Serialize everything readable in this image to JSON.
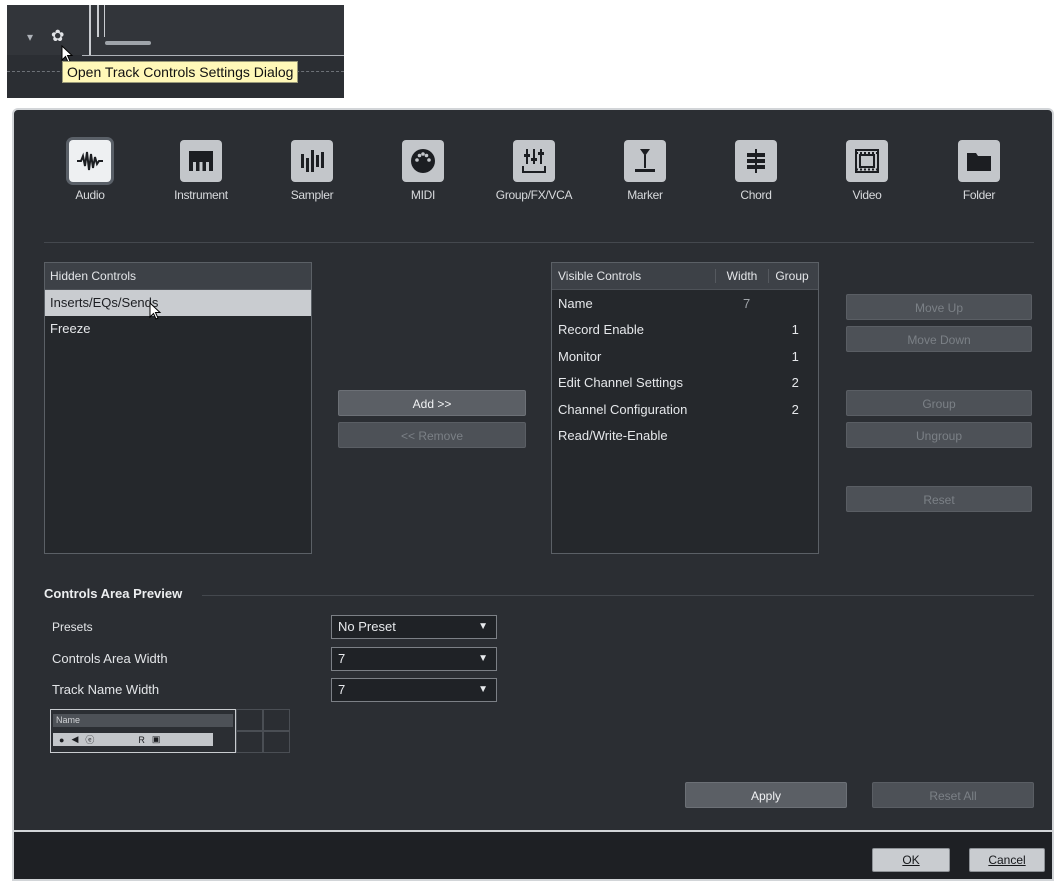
{
  "toolbar_snippet": {
    "tooltip": "Open Track Controls Settings Dialog",
    "icons": [
      "dropdown-arrow-icon",
      "gear-icon"
    ]
  },
  "categories": [
    {
      "label": "Audio",
      "icon": "waveform-icon",
      "selected": true
    },
    {
      "label": "Instrument",
      "icon": "piano-keys-icon",
      "selected": false
    },
    {
      "label": "Sampler",
      "icon": "sampler-bars-icon",
      "selected": false
    },
    {
      "label": "MIDI",
      "icon": "midi-port-icon",
      "selected": false
    },
    {
      "label": "Group/FX/VCA",
      "icon": "faders-icon",
      "selected": false
    },
    {
      "label": "Marker",
      "icon": "marker-icon",
      "selected": false
    },
    {
      "label": "Chord",
      "icon": "chord-icon",
      "selected": false
    },
    {
      "label": "Video",
      "icon": "film-icon",
      "selected": false
    },
    {
      "label": "Folder",
      "icon": "folder-icon",
      "selected": false
    }
  ],
  "hidden_controls": {
    "header": "Hidden Controls",
    "items": [
      {
        "label": "Inserts/EQs/Sends",
        "selected": true
      },
      {
        "label": "Freeze",
        "selected": false
      }
    ]
  },
  "transfer_buttons": {
    "add": "Add >>",
    "remove": "<< Remove"
  },
  "visible_controls": {
    "headers": {
      "name": "Visible Controls",
      "width": "Width",
      "group": "Group"
    },
    "rows": [
      {
        "name": "Name",
        "width": "7",
        "group": ""
      },
      {
        "name": "Record Enable",
        "width": "",
        "group": "1"
      },
      {
        "name": "Monitor",
        "width": "",
        "group": "1"
      },
      {
        "name": "Edit Channel Settings",
        "width": "",
        "group": "2"
      },
      {
        "name": "Channel Configuration",
        "width": "",
        "group": "2"
      },
      {
        "name": "Read/Write-Enable",
        "width": "",
        "group": ""
      }
    ]
  },
  "side_buttons": {
    "move_up": "Move Up",
    "move_down": "Move Down",
    "group": "Group",
    "ungroup": "Ungroup",
    "reset": "Reset"
  },
  "preview": {
    "title": "Controls Area Preview",
    "presets_label": "Presets",
    "presets_value": "No Preset",
    "width_label": "Controls Area Width",
    "width_value": "7",
    "name_width_label": "Track Name Width",
    "name_width_value": "7",
    "track_name": "Name"
  },
  "footer": {
    "apply": "Apply",
    "reset_all": "Reset All",
    "ok": "OK",
    "cancel": "Cancel"
  },
  "colors": {
    "dialog_bg": "#2b2e33",
    "tooltip_bg": "#fff8b8",
    "selected_row": "#c9ccd0"
  }
}
